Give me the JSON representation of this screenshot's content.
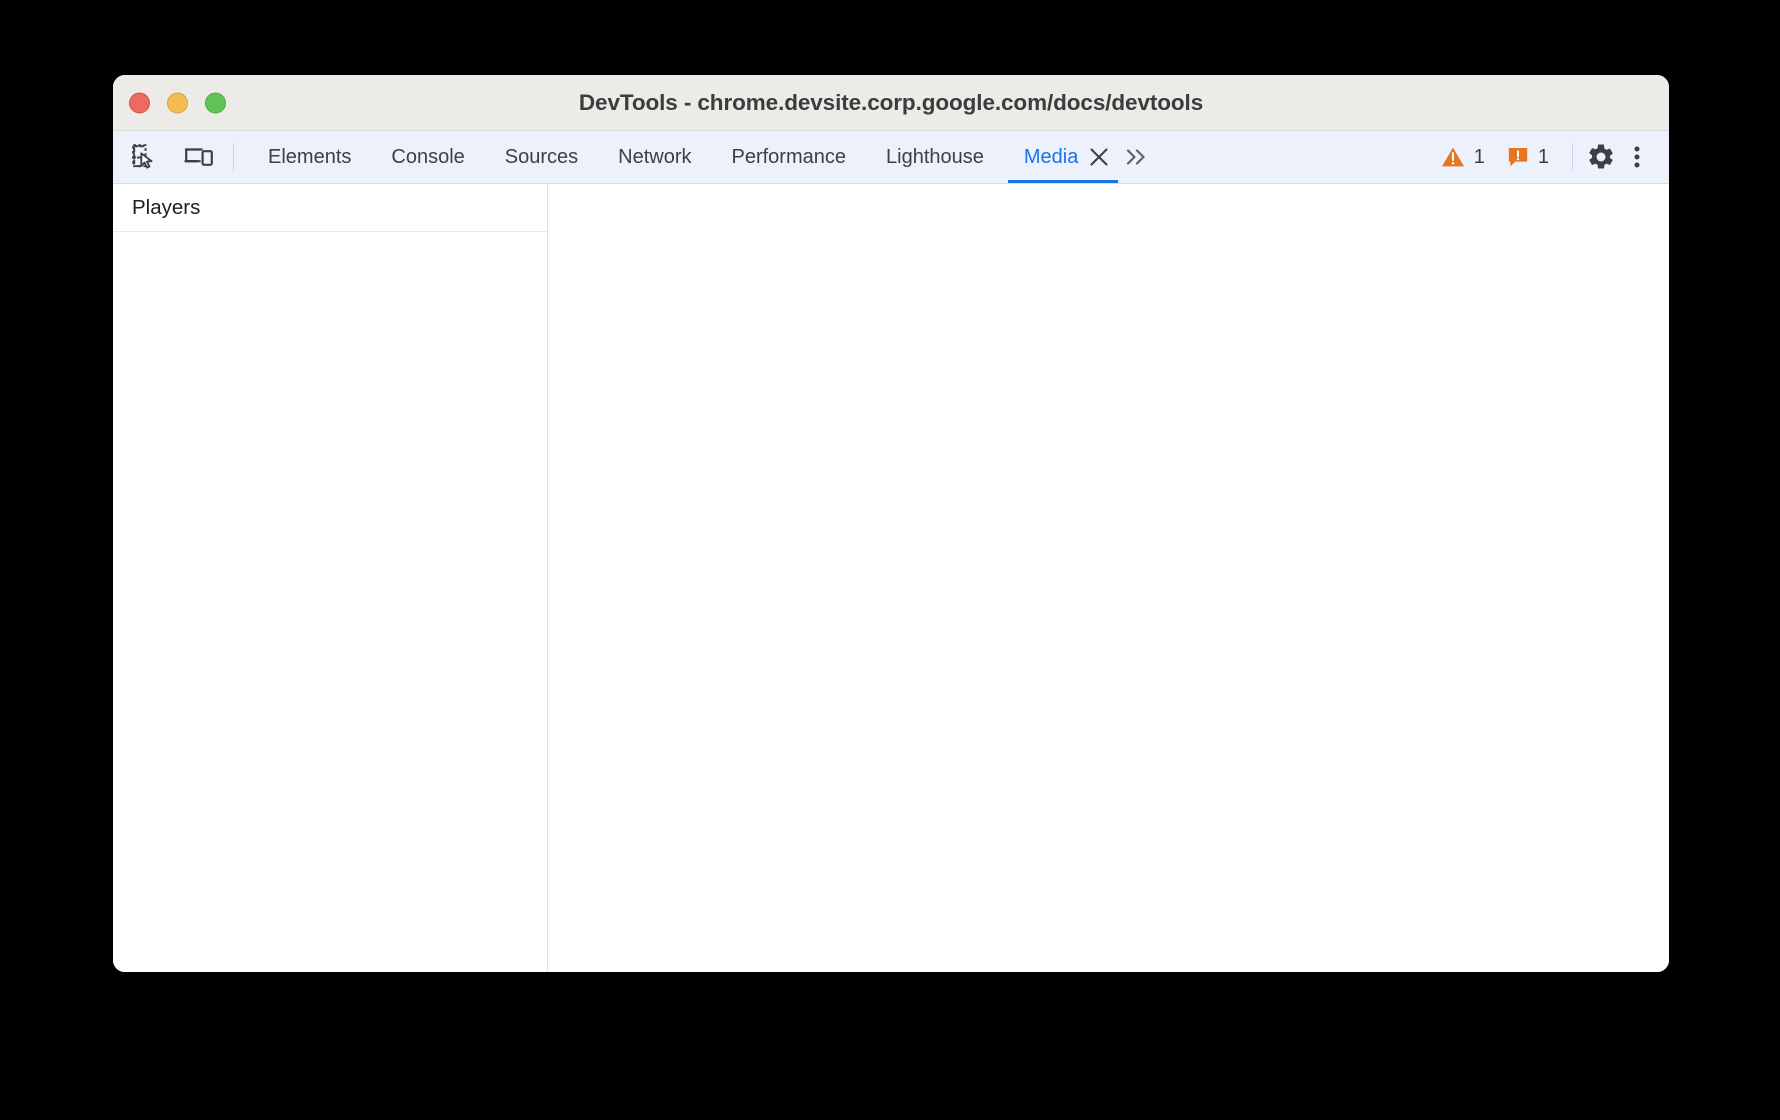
{
  "window": {
    "title": "DevTools - chrome.devsite.corp.google.com/docs/devtools",
    "traffic_lights": [
      {
        "name": "close",
        "color": "#ED6A5E"
      },
      {
        "name": "minimize",
        "color": "#F5BD4F"
      },
      {
        "name": "maximize",
        "color": "#61C454"
      }
    ]
  },
  "toolbar": {
    "left_icons": [
      {
        "name": "inspect-element-icon",
        "title": "Inspect element"
      },
      {
        "name": "device-toolbar-icon",
        "title": "Toggle device toolbar"
      }
    ],
    "tabs": [
      {
        "label": "Elements",
        "active": false
      },
      {
        "label": "Console",
        "active": false
      },
      {
        "label": "Sources",
        "active": false
      },
      {
        "label": "Network",
        "active": false
      },
      {
        "label": "Performance",
        "active": false
      },
      {
        "label": "Lighthouse",
        "active": false
      },
      {
        "label": "Media",
        "active": true
      }
    ],
    "active_tab": "Media",
    "close_tab_label": "×",
    "overflow_label": "»",
    "warnings": {
      "icon": "warning-triangle-icon",
      "count": "1",
      "color": "#E8761F"
    },
    "issues": {
      "icon": "issue-square-icon",
      "count": "1",
      "color": "#E8761F"
    },
    "settings_label": "gear-icon",
    "more_label": "kebab-menu-icon",
    "accent_color": "#1A73E8"
  },
  "sidebar": {
    "header": "Players",
    "items": []
  },
  "main": {
    "content": ""
  }
}
